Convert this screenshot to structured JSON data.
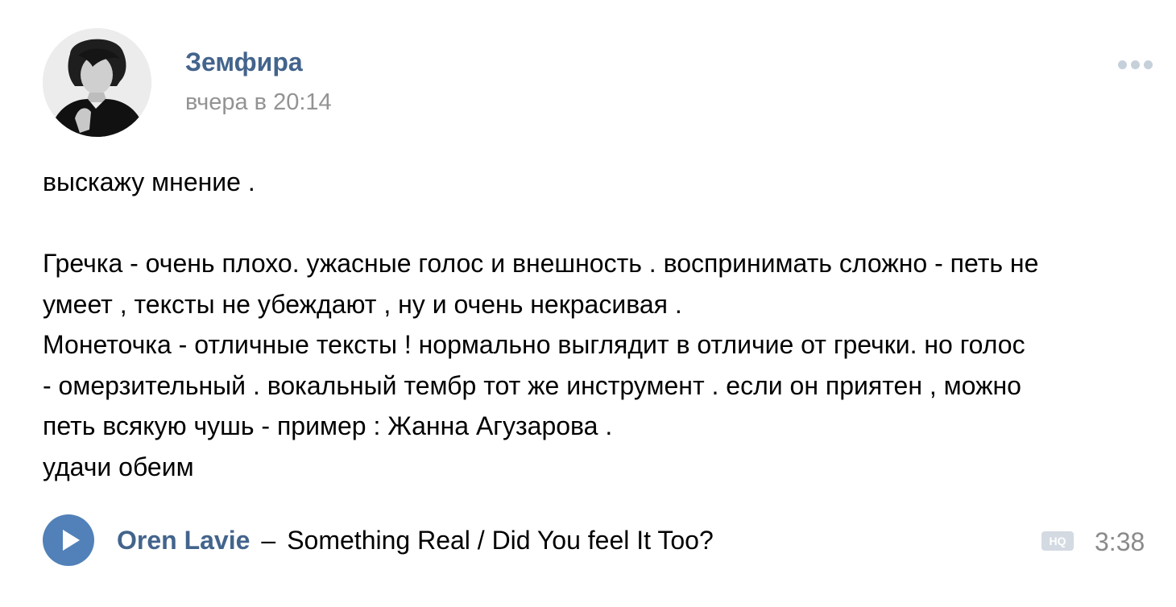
{
  "post": {
    "author": "Земфира",
    "time": "вчера в 20:14",
    "avatar_icon": "person-photo-avatar",
    "more_icon": "more-dots-icon",
    "text_lines": [
      "выскажу мнение .",
      "",
      "Гречка - очень плохо. ужасные голос и внешность . воспринимать сложно - петь не",
      "умеет , тексты не убеждают , ну и очень некрасивая .",
      "Монеточка - отличные тексты ! нормально выглядит в отличие от гречки. но голос",
      "- омерзительный . вокальный тембр тот же инструмент . если он приятен , можно",
      "петь всякую чушь - пример : Жанна Агузарова .",
      "удачи обеим"
    ]
  },
  "audio": {
    "artist": "Oren Lavie",
    "separator": "–",
    "title": "Something Real / Did You feel It Too?",
    "quality_badge": "HQ",
    "duration": "3:38",
    "play_icon": "play-icon"
  },
  "colors": {
    "link": "#43648c",
    "play_button": "#5181b8",
    "muted": "#939393",
    "badge": "#d3dae2"
  }
}
